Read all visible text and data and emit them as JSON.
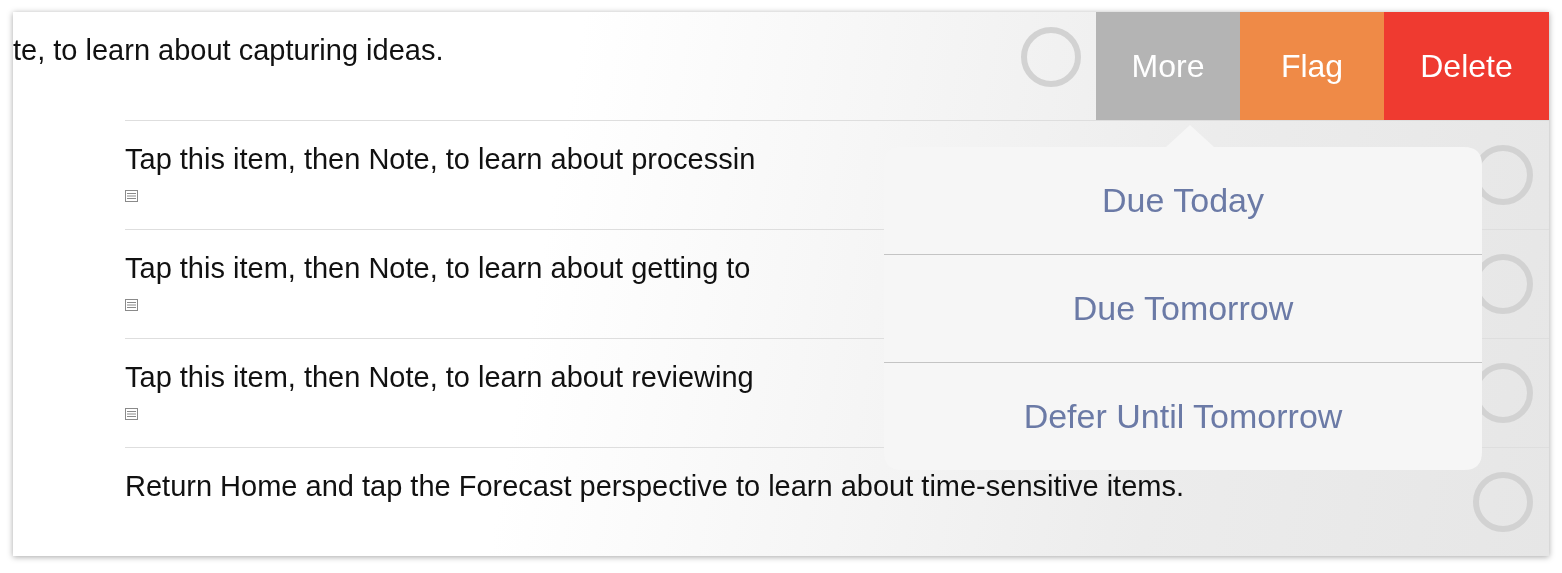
{
  "swiped_row": {
    "text": "te, to learn about capturing ideas.",
    "checked": false,
    "actions": [
      {
        "label": "More",
        "color": "#b4b4b4"
      },
      {
        "label": "Flag",
        "color": "#ef8a47"
      },
      {
        "label": "Delete",
        "color": "#ef3a30"
      }
    ]
  },
  "rows": [
    {
      "text": "Tap this item, then Note, to learn about processin",
      "has_note": true,
      "checked": false
    },
    {
      "text": "Tap this item, then Note, to learn about getting to",
      "has_note": true,
      "checked": false
    },
    {
      "text": "Tap this item, then Note, to learn about reviewing",
      "has_note": true,
      "checked": false
    },
    {
      "text": "Return Home and tap the Forecast perspective to learn about time-sensitive items.",
      "has_note": false,
      "checked": false
    }
  ],
  "popover": {
    "items": [
      "Due Today",
      "Due Tomorrow",
      "Defer Until Tomorrow"
    ]
  }
}
